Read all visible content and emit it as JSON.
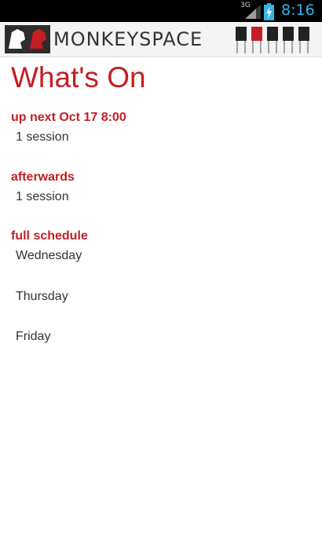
{
  "status_bar": {
    "network": "3G",
    "clock": "8:16"
  },
  "header": {
    "brand": "MONKEYSPACE"
  },
  "page_title": "What's On",
  "sections": {
    "up_next": {
      "title": "up next Oct 17 8:00",
      "items": [
        "1 session"
      ]
    },
    "afterwards": {
      "title": "afterwards",
      "items": [
        "1 session"
      ]
    },
    "full_schedule": {
      "title": "full schedule",
      "items": [
        "Wednesday",
        "Thursday",
        "Friday"
      ]
    }
  },
  "colors": {
    "accent": "#c41e24",
    "status_clock": "#33b5e5",
    "text": "#333333"
  }
}
